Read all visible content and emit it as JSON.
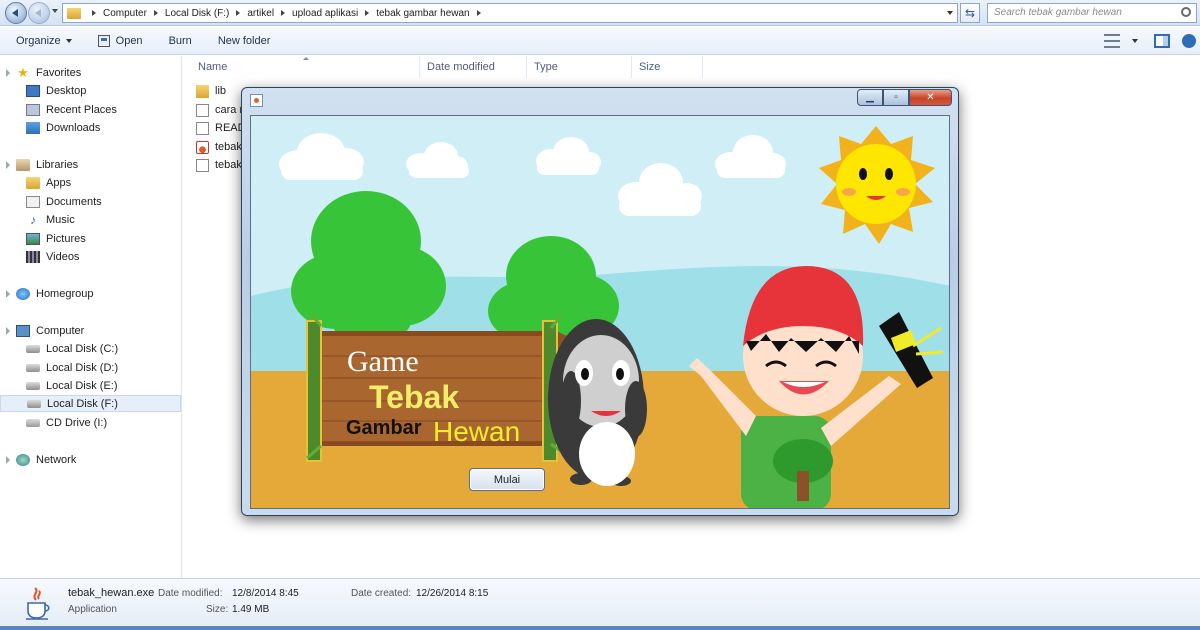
{
  "address_bar": {
    "breadcrumbs": [
      "Computer",
      "Local Disk (F:)",
      "artikel",
      "upload aplikasi",
      "tebak gambar hewan"
    ],
    "search_placeholder": "Search tebak gambar hewan"
  },
  "toolbar": {
    "organize": "Organize",
    "open": "Open",
    "burn": "Burn",
    "new_folder": "New folder"
  },
  "sidebar": {
    "favorites": "Favorites",
    "favorites_items": [
      "Desktop",
      "Recent Places",
      "Downloads"
    ],
    "libraries": "Libraries",
    "libraries_items": [
      "Apps",
      "Documents",
      "Music",
      "Pictures",
      "Videos"
    ],
    "homegroup": "Homegroup",
    "computer": "Computer",
    "computer_items": [
      "Local Disk (C:)",
      "Local Disk (D:)",
      "Local Disk (E:)",
      "Local Disk (F:)",
      "CD Drive (I:)"
    ],
    "selected_drive": "Local Disk (F:)",
    "network": "Network"
  },
  "file_list": {
    "columns": [
      "Name",
      "Date modified",
      "Type",
      "Size"
    ],
    "files": [
      {
        "name": "lib",
        "icon": "folder-icon"
      },
      {
        "name": "cara m",
        "icon": "text-file-icon"
      },
      {
        "name": "READ",
        "icon": "text-file-icon"
      },
      {
        "name": "tebak",
        "icon": "java-file-icon"
      },
      {
        "name": "tebak",
        "icon": "text-file-icon"
      }
    ]
  },
  "details_pane": {
    "file_name": "tebak_hewan.exe",
    "file_type": "Application",
    "date_modified_label": "Date modified:",
    "date_modified": "12/8/2014 8:45",
    "size_label": "Size:",
    "size": "1.49 MB",
    "date_created_label": "Date created:",
    "date_created": "12/26/2014 8:15"
  },
  "game_window": {
    "title_line1": "Game",
    "title_line2": "Tebak",
    "title_line3a": "Gambar",
    "title_line3b": "Hewan",
    "start_button": "Mulai",
    "colors": {
      "sky": "#cfeef5",
      "ground": "#e5a93a",
      "tree": "#38c438",
      "sign_wood": "#8a4a1f",
      "title_yellow": "#f2ee6a",
      "sun": "#ffe600"
    }
  }
}
